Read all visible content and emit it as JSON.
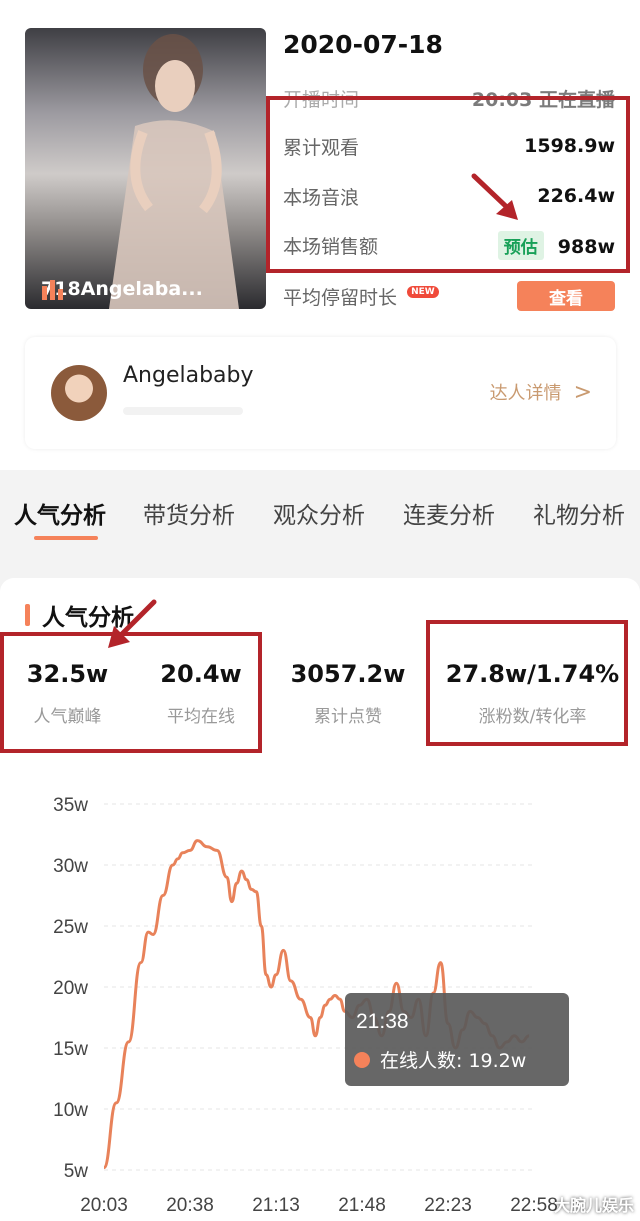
{
  "live": {
    "date": "2020-07-18",
    "thumbnail_label": "718Angelaba...",
    "rows": [
      {
        "label": "开播时间",
        "value": "20:03    正在直播"
      },
      {
        "label": "累计观看",
        "value": "1598.9w"
      },
      {
        "label": "本场音浪",
        "value": "226.4w"
      },
      {
        "label": "本场销售额",
        "value": "988w",
        "tag": "预估"
      },
      {
        "label": "平均停留时长",
        "badge": "NEW",
        "button": "查看"
      }
    ]
  },
  "anchor": {
    "name": "Angelababy",
    "detail_link": "达人详情",
    "chevron": ">"
  },
  "tabs": [
    {
      "label": "人气分析",
      "active": true
    },
    {
      "label": "带货分析"
    },
    {
      "label": "观众分析"
    },
    {
      "label": "连麦分析"
    },
    {
      "label": "礼物分析"
    }
  ],
  "section": {
    "title": "人气分析",
    "stats": [
      {
        "value": "32.5w",
        "caption": "人气巅峰"
      },
      {
        "value": "20.4w",
        "caption": "平均在线"
      },
      {
        "value": "3057.2w",
        "caption": "累计点赞"
      },
      {
        "value": "27.8w/1.74%",
        "caption": "涨粉数/转化率"
      }
    ]
  },
  "chart_data": {
    "type": "line",
    "x_labels": [
      "20:03",
      "20:38",
      "21:13",
      "21:48",
      "22:23",
      "22:58"
    ],
    "y_ticks": [
      "5w",
      "10w",
      "15w",
      "20w",
      "25w",
      "30w",
      "35w"
    ],
    "ylim": [
      5,
      35
    ],
    "xlim": [
      0,
      175
    ],
    "unit": "w",
    "series": [
      {
        "name": "在线人数",
        "color": "#e8825a",
        "x": [
          0,
          5,
          10,
          15,
          18,
          20,
          24,
          28,
          30,
          32,
          35,
          38,
          42,
          46,
          50,
          52,
          54,
          56,
          58,
          60,
          62,
          64,
          66,
          68,
          70,
          73,
          76,
          80,
          84,
          86,
          88,
          90,
          92,
          94,
          96,
          98,
          101,
          104,
          107,
          110,
          113,
          116,
          119,
          122,
          125,
          128,
          131,
          134,
          137,
          140,
          143,
          146,
          149,
          152,
          155,
          158,
          161,
          164,
          167,
          170,
          173
        ],
        "y": [
          5.2,
          10.5,
          15.5,
          22.0,
          24.5,
          24.3,
          27.5,
          30.0,
          30.5,
          31.0,
          31.2,
          32.0,
          31.5,
          31.2,
          29.0,
          27.0,
          28.5,
          29.5,
          28.8,
          28.0,
          27.8,
          25.0,
          21.0,
          20.0,
          21.0,
          23.0,
          20.5,
          19.0,
          17.5,
          16.0,
          17.5,
          18.5,
          19.0,
          19.3,
          19.0,
          18.0,
          17.5,
          18.5,
          19.0,
          17.5,
          16.0,
          18.0,
          20.3,
          18.0,
          17.5,
          19.0,
          16.0,
          19.5,
          22.0,
          17.0,
          15.0,
          16.5,
          18.0,
          17.5,
          17.0,
          16.0,
          15.0,
          15.5,
          16.0,
          15.5,
          16.0
        ]
      }
    ],
    "tooltip": {
      "time": "21:38",
      "label": "在线人数: 19.2w"
    }
  },
  "watermark": "大腕儿娱乐",
  "colors": {
    "accent": "#f5825a",
    "annotation_red": "#b3242a",
    "estimate_green": "#18a058"
  }
}
